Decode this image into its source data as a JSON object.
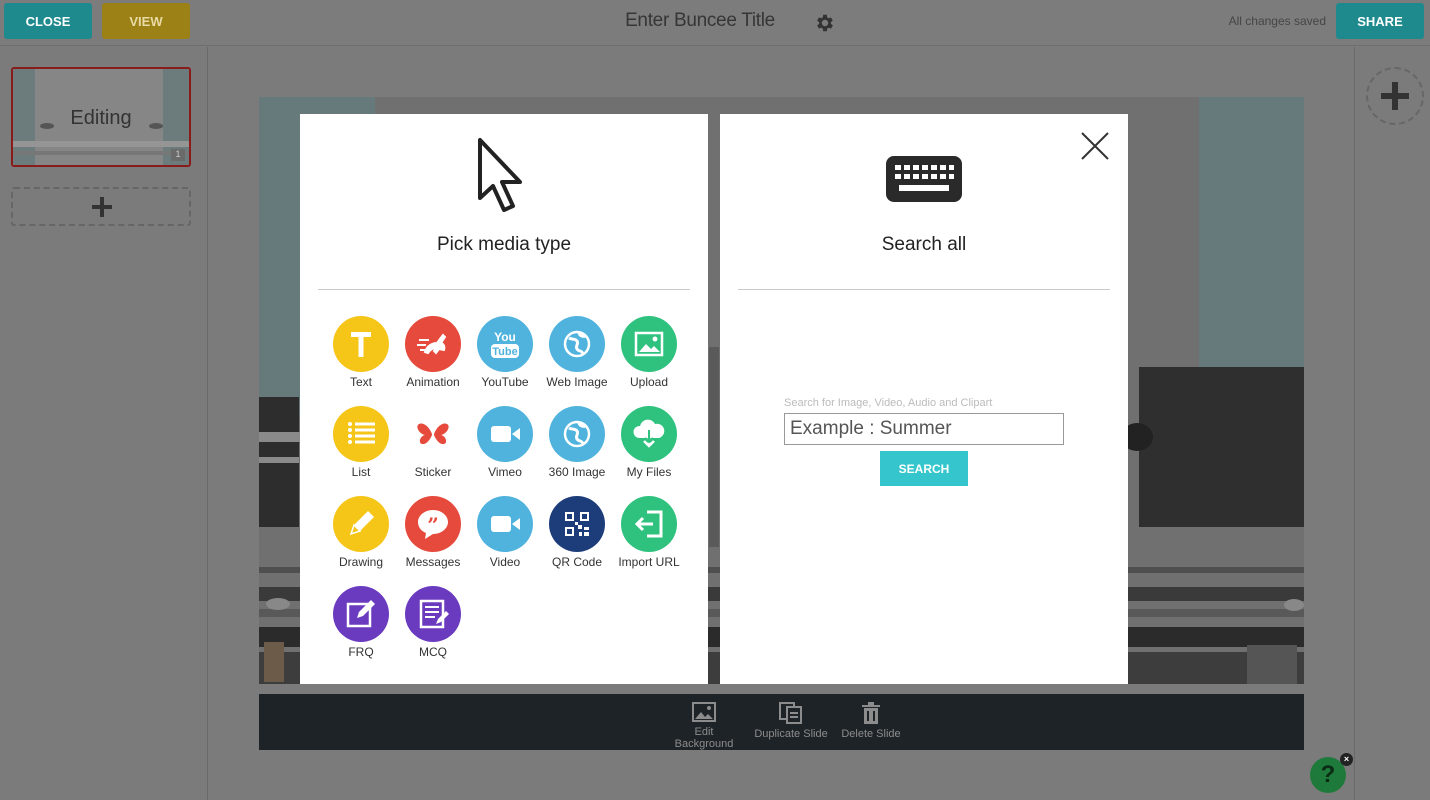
{
  "topbar": {
    "close_label": "CLOSE",
    "view_label": "VIEW",
    "title": "Enter Buncee Title",
    "status": "All changes saved",
    "share_label": "SHARE"
  },
  "slides": {
    "thumb_label": "Editing",
    "thumb_number": "1"
  },
  "media_panel": {
    "heading": "Pick media type",
    "items": [
      {
        "label": "Text",
        "icon": "text-icon",
        "color": "#f5c518"
      },
      {
        "label": "Animation",
        "icon": "animation-icon",
        "color": "#e64a3c"
      },
      {
        "label": "YouTube",
        "icon": "youtube-icon",
        "color": "#4fb3de"
      },
      {
        "label": "Web Image",
        "icon": "globe-icon",
        "color": "#4fb3de"
      },
      {
        "label": "Upload",
        "icon": "image-icon",
        "color": "#2ec27e"
      },
      {
        "label": "List",
        "icon": "list-icon",
        "color": "#f5c518"
      },
      {
        "label": "Sticker",
        "icon": "butterfly-icon",
        "color": "#ffffff"
      },
      {
        "label": "Vimeo",
        "icon": "video-camera-icon",
        "color": "#4fb3de"
      },
      {
        "label": "360 Image",
        "icon": "globe-icon",
        "color": "#4fb3de"
      },
      {
        "label": "My Files",
        "icon": "cloud-download-icon",
        "color": "#2ec27e"
      },
      {
        "label": "Drawing",
        "icon": "pencil-icon",
        "color": "#f5c518"
      },
      {
        "label": "Messages",
        "icon": "quote-bubble-icon",
        "color": "#e64a3c"
      },
      {
        "label": "Video",
        "icon": "video-camera-icon",
        "color": "#4fb3de"
      },
      {
        "label": "QR Code",
        "icon": "qr-code-icon",
        "color": "#1d3d7a"
      },
      {
        "label": "Import URL",
        "icon": "import-icon",
        "color": "#2ec27e"
      },
      {
        "label": "FRQ",
        "icon": "edit-icon",
        "color": "#6a3bbf"
      },
      {
        "label": "MCQ",
        "icon": "checklist-icon",
        "color": "#6a3bbf"
      }
    ]
  },
  "search_panel": {
    "heading": "Search all",
    "hint": "Search for Image, Video, Audio and Clipart",
    "placeholder": "Example : Summer",
    "button_label": "SEARCH"
  },
  "bottom_toolbar": {
    "edit_background": "Edit Background",
    "duplicate_slide": "Duplicate Slide",
    "delete_slide": "Delete Slide"
  },
  "help": {
    "label": "?",
    "close": "×"
  }
}
